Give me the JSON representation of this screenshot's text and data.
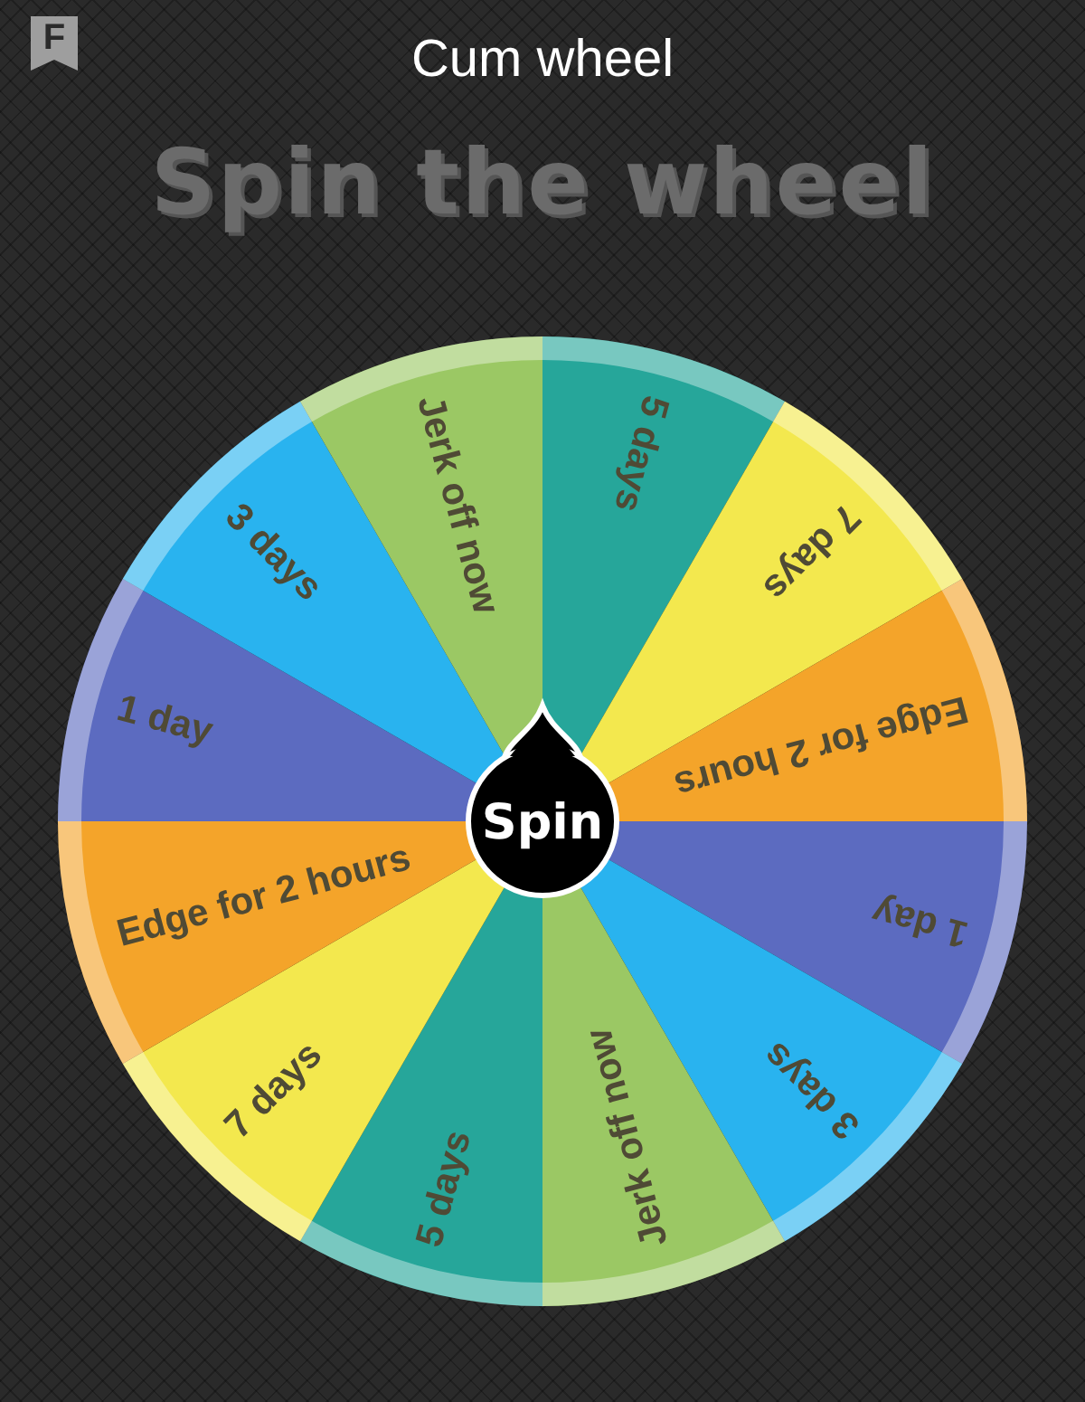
{
  "app_badge": {
    "letter": "F"
  },
  "title": "Cum wheel",
  "heading": "Spin the wheel",
  "wheel": {
    "center_button": "Spin",
    "segments": [
      {
        "label": "5 days",
        "color": "#26a69a"
      },
      {
        "label": "7 days",
        "color": "#f3e84e"
      },
      {
        "label": "Edge for 2 hours",
        "color": "#f4a42a"
      },
      {
        "label": "1 day",
        "color": "#5c6bc0"
      },
      {
        "label": "3 days",
        "color": "#29b3ef"
      },
      {
        "label": "Jerk off now",
        "color": "#9bc864"
      },
      {
        "label": "5 days",
        "color": "#26a69a"
      },
      {
        "label": "7 days",
        "color": "#f3e84e"
      },
      {
        "label": "Edge for 2 hours",
        "color": "#f4a42a"
      },
      {
        "label": "1 day",
        "color": "#5c6bc0"
      },
      {
        "label": "3 days",
        "color": "#29b3ef"
      },
      {
        "label": "Jerk off now",
        "color": "#9bc864"
      }
    ]
  }
}
